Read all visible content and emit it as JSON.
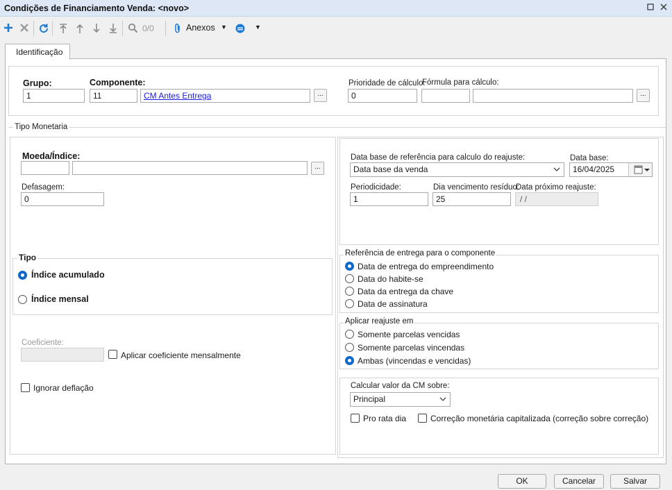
{
  "window": {
    "title": "Condições de Financiamento Venda: <novo>",
    "restore_icon": "restore-icon",
    "close_icon": "close-icon"
  },
  "toolbar": {
    "icons": [
      "add-icon",
      "delete-icon",
      "refresh-icon",
      "move-first-icon",
      "move-up-icon",
      "move-down-icon",
      "move-last-icon",
      "search-icon",
      "attachment-icon",
      "record-icon"
    ],
    "counter": "0/0",
    "attachments_label": "Anexos"
  },
  "tabs": [
    {
      "label": "Identificação"
    }
  ],
  "identification": {
    "grupo_label": "Grupo",
    "grupo_value": "1",
    "componente_label": "Componente",
    "componente_code": "11",
    "componente_name": "CM Antes Entrega",
    "prioridade_label": "Prioridade de cálculo:",
    "prioridade_value": "0",
    "formula_label": "Fórmula para cálculo:",
    "formula_code": "",
    "formula_name": "",
    "ellipsis": "..."
  },
  "tipo_monetaria": {
    "legend": "Tipo Monetaria",
    "moeda_label": "Moeda/Índice",
    "moeda_code": "",
    "moeda_name": "",
    "defasagem_label": "Defasagem:",
    "defasagem_value": "0",
    "tipo_label": "Tipo",
    "tipo_options": [
      {
        "label": "Índice acumulado",
        "selected": true
      },
      {
        "label": "Índice mensal",
        "selected": false
      }
    ],
    "coeficiente_label": "Coeficiente:",
    "coeficiente_value": "",
    "aplicar_coef_label": "Aplicar coeficiente mensalmente",
    "ignorar_deflacao_label": "Ignorar deflação"
  },
  "reajuste": {
    "data_base_ref_label": "Data base de referência para calculo do reajuste:",
    "data_base_ref_value": "Data base da venda",
    "data_base_label": "Data base:",
    "data_base_value": "16/04/2025",
    "periodicidade_label": "Periodicidade:",
    "periodicidade_value": "1",
    "dia_venc_label": "Dia vencimento resíduo:",
    "dia_venc_value": "25",
    "data_prox_label": "Data próximo reajuste:",
    "data_prox_value": " /  /",
    "highlight_color": "#f2e600"
  },
  "referencia_entrega": {
    "legend": "Referência de entrega para o componente",
    "options": [
      {
        "label": "Data de entrega do empreendimento",
        "selected": true
      },
      {
        "label": "Data do habite-se",
        "selected": false
      },
      {
        "label": "Data da entrega da chave",
        "selected": false
      },
      {
        "label": "Data de assinatura",
        "selected": false
      }
    ]
  },
  "aplicar_reajuste": {
    "legend": "Aplicar reajuste em",
    "options": [
      {
        "label": "Somente parcelas vencidas",
        "selected": false
      },
      {
        "label": "Somente parcelas vincendas",
        "selected": false
      },
      {
        "label": "Ambas (vincendas e vencidas)",
        "selected": true
      }
    ]
  },
  "calcular_cm": {
    "label": "Calcular valor da CM sobre:",
    "value": "Principal",
    "pro_rata_label": "Pro rata dia",
    "correcao_label": "Correção monetária capitalizada (correção sobre correção)"
  },
  "footer": {
    "ok_label": "OK",
    "cancel_label": "Cancelar",
    "save_label": "Salvar"
  },
  "colors": {
    "accent": "#0f68c9",
    "titlebar": "#dde7f6",
    "link": "#1a1ae6"
  }
}
